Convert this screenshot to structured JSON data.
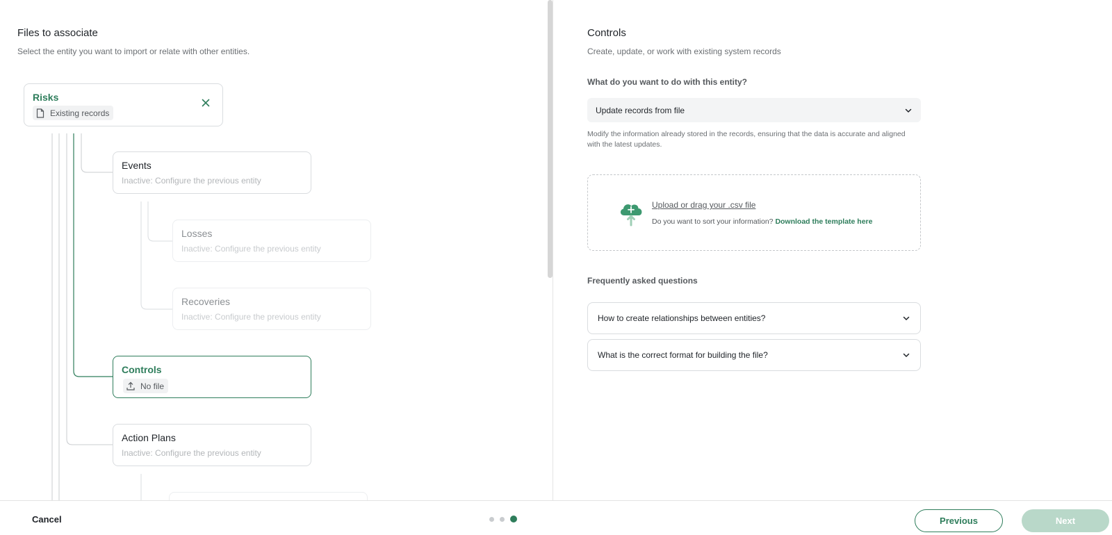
{
  "left": {
    "title": "Files to associate",
    "subtitle": "Select the entity you want to import or relate with other entities."
  },
  "tree": {
    "risks": {
      "title": "Risks",
      "chip": "Existing records"
    },
    "events": {
      "title": "Events",
      "status": "Inactive: Configure the previous entity"
    },
    "losses": {
      "title": "Losses",
      "status": "Inactive: Configure the previous entity"
    },
    "recoveries": {
      "title": "Recoveries",
      "status": "Inactive: Configure the previous entity"
    },
    "controls": {
      "title": "Controls",
      "chip": "No file"
    },
    "action_plans": {
      "title": "Action Plans",
      "status": "Inactive: Configure the previous entity"
    }
  },
  "right": {
    "title": "Controls",
    "subtitle": "Create, update, or work with existing system records",
    "question": "What do you want to do with this entity?",
    "select_value": "Update records from file",
    "select_description": "Modify the information already stored in the records, ensuring that the data is accurate and aligned with the latest updates.",
    "upload": {
      "link": "Upload or drag your .csv file",
      "hint": "Do you want to sort your information?",
      "template_link": "Download the template here"
    },
    "faq": {
      "title": "Frequently asked questions",
      "items": [
        "How to create relationships between entities?",
        "What is the correct format for building the file?"
      ]
    }
  },
  "footer": {
    "cancel": "Cancel",
    "previous": "Previous",
    "next": "Next",
    "step_current": 3,
    "step_total": 3
  },
  "colors": {
    "accent": "#2e7d5b",
    "accent_disabled": "#b9d8c9",
    "border": "#d9dcdf",
    "muted_text": "#b3b6b9"
  }
}
